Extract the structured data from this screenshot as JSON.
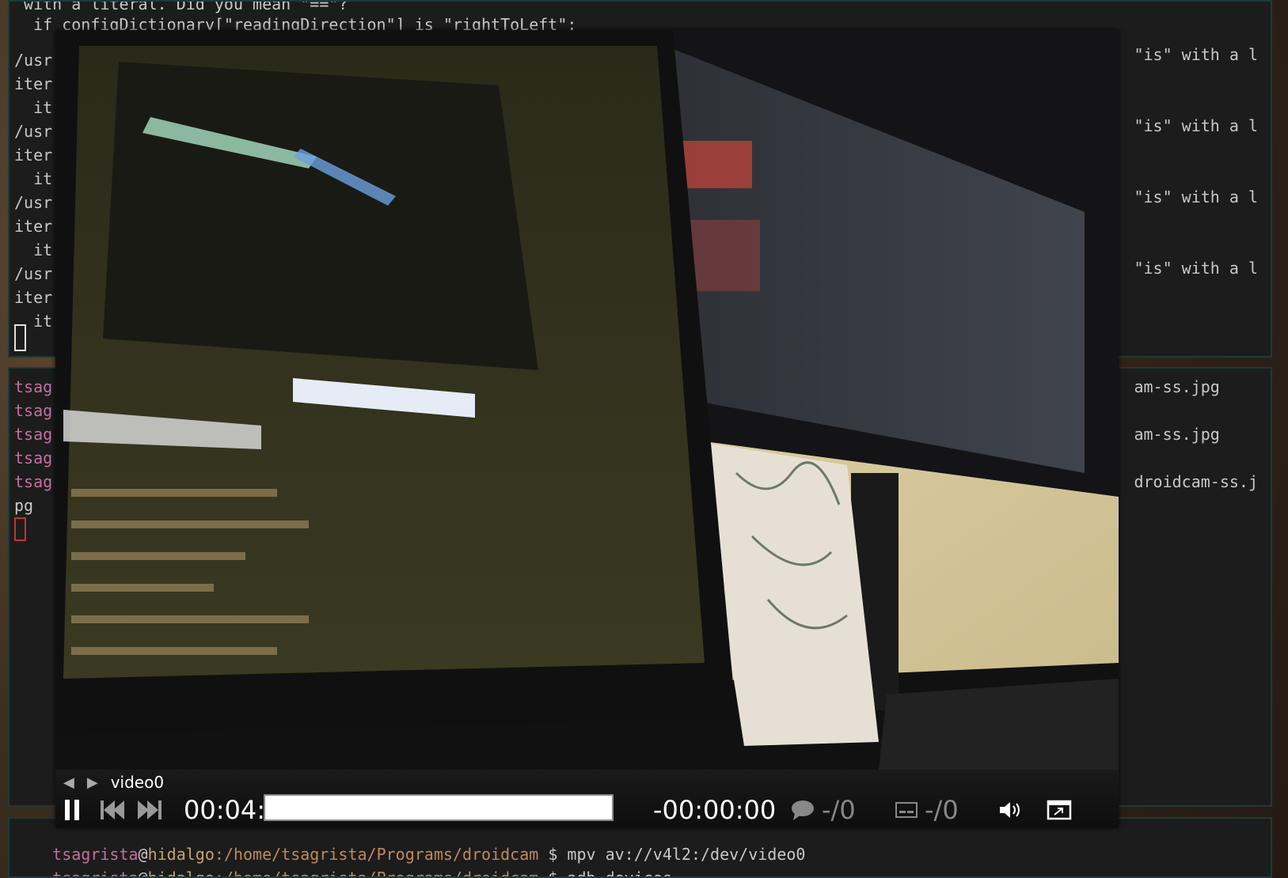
{
  "term_top": {
    "lines": [
      " with a literal. Did you mean \"==\"?",
      "  if configDictionary[\"readingDirection\"] is \"rightToLeft\":",
      "/usr",
      "iter",
      "  it",
      "/usr",
      "iter",
      "  it",
      "/usr",
      "iter",
      "  it",
      "/usr",
      "iter",
      "  it"
    ],
    "right_lines": [
      "\"is\" with a l",
      "\"is\" with a l",
      "\"is\" with a l",
      "\"is\" with a l"
    ]
  },
  "term_mid": {
    "lines": [
      "tsag",
      "tsag",
      "tsag",
      "tsag",
      "tsag",
      "pg"
    ],
    "right_lines": [
      "am-ss.jpg",
      "am-ss.jpg",
      "droidcam-ss.j"
    ]
  },
  "term_bot": {
    "prompt1": {
      "user": "tsagrista",
      "at": "@",
      "host": "hidalgo",
      "path": ":/home/tsagrista/Programs/droidcam",
      "cmd": " $ mpv av://v4l2:/dev/video0"
    },
    "prompt2": {
      "user": "tsagrista",
      "at": "@",
      "host": "hidalgo",
      "path": ":/home/tsagrista/Programs/droidcam",
      "cmd": " $ adb devices"
    }
  },
  "player": {
    "title": "video0",
    "time_elapsed": "00:04:17",
    "time_remaining": "-00:00:00",
    "subtitle_track": "-/0",
    "audio_track": "-/0"
  },
  "icons": {
    "prev": "triangle-left-icon",
    "next": "triangle-right-icon",
    "pause": "pause-icon",
    "skip_back": "skip-back-icon",
    "skip_forward": "skip-forward-icon",
    "chat": "speech-bubble-icon",
    "subtitles": "subtitles-icon",
    "volume": "speaker-icon",
    "fullscreen": "window-icon"
  }
}
